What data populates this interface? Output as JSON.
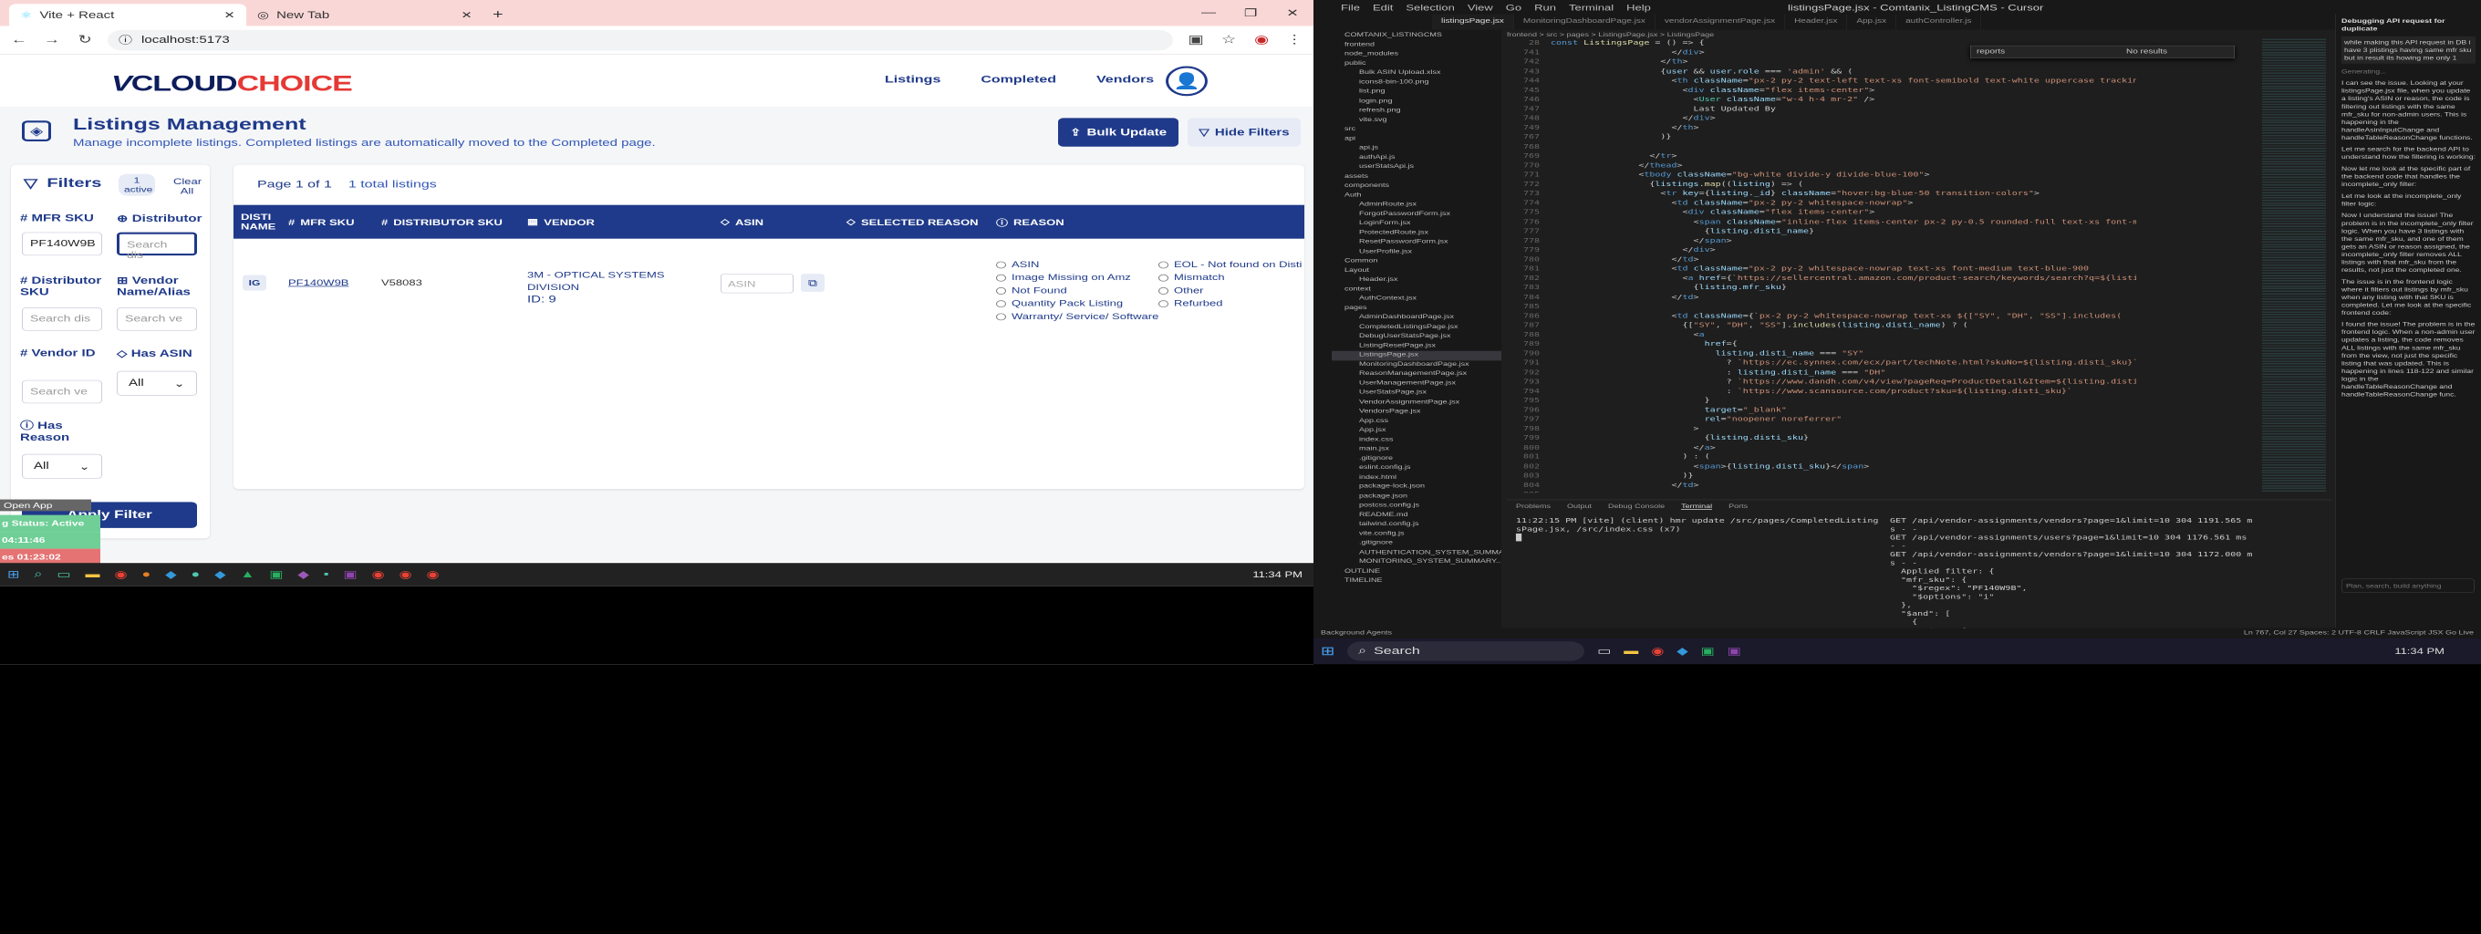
{
  "browser": {
    "tabs": [
      {
        "title": "Vite + React"
      },
      {
        "title": "New Tab"
      }
    ],
    "url": "localhost:5173"
  },
  "app": {
    "logo": {
      "v": "V",
      "cloud": "CLOUD",
      "choice": "CHOICE"
    },
    "nav": [
      "Listings",
      "Completed",
      "Vendors"
    ],
    "header": {
      "title": "Listings Management",
      "subtitle": "Manage incomplete listings. Completed listings are automatically moved to the Completed page.",
      "bulk_update": "Bulk Update",
      "hide_filters": "Hide Filters"
    },
    "filters": {
      "title": "Filters",
      "active_badge": "1 active",
      "clear_all": "Clear All",
      "mfr_sku_label": "MFR SKU",
      "mfr_sku_value": "PF140W9B",
      "distributor_label": "Distributor",
      "distributor_placeholder": "Search dis",
      "distributor_sku_label": "Distributor SKU",
      "distributor_sku_placeholder": "Search dis",
      "vendor_name_label": "Vendor Name/Alias",
      "vendor_name_placeholder": "Search ve",
      "vendor_id_label": "Vendor ID",
      "vendor_id_placeholder": "Search ve",
      "has_asin_label": "Has ASIN",
      "has_asin_value": "All",
      "has_reason_label": "Has Reason",
      "has_reason_value": "All",
      "apply": "Apply Filter"
    },
    "table": {
      "page_info": "Page 1 of 1",
      "total": "1 total listings",
      "columns": [
        "DISTI NAME",
        "MFR SKU",
        "DISTRIBUTOR SKU",
        "VENDOR",
        "ASIN",
        "SELECTED REASON",
        "REASON"
      ],
      "row": {
        "disti": "IG",
        "mfr_sku": "PF140W9B",
        "disti_sku": "V58083",
        "vendor": "3M - OPTICAL SYSTEMS DIVISION",
        "vendor_id": "ID: 9",
        "asin_placeholder": "ASIN",
        "reasons_a": [
          "ASIN",
          "Image Missing on Amz",
          "Not Found",
          "Quantity Pack Listing",
          "Warranty/ Service/ Software"
        ],
        "reasons_b": [
          "EOL - Not found on Disti",
          "Mismatch",
          "Other",
          "Refurbed"
        ]
      }
    },
    "side_widget": {
      "open_app": "Open App",
      "status": "g Status: Active",
      "time1": "04:11:46",
      "time2": "es 01:23:02"
    },
    "taskbar_clock": "11:34 PM"
  },
  "vscode": {
    "menu": [
      "File",
      "Edit",
      "Selection",
      "View",
      "Go",
      "Run",
      "Terminal",
      "Help"
    ],
    "title": "listingsPage.jsx - Comtanix_ListingCMS - Cursor",
    "tabs": [
      "listingsPage.jsx",
      "MonitoringDashboardPage.jsx",
      "vendorAssignmentPage.jsx",
      "Header.jsx",
      "App.jsx",
      "authController.js"
    ],
    "breadcrumb": "frontend > src > pages > ListingsPage.jsx > ListingsPage",
    "find_text": "reports",
    "find_result": "No results",
    "explorer": [
      "COMTANIX_LISTINGCMS",
      "frontend",
      "node_modules",
      "public",
      "Bulk ASIN Upload.xlsx",
      "icons8-bin-100.png",
      "list.png",
      "login.png",
      "refresh.png",
      "vite.svg",
      "src",
      "api",
      "api.js",
      "authApi.js",
      "userStatsApi.js",
      "assets",
      "components",
      "Auth",
      "AdminRoute.jsx",
      "ForgotPasswordForm.jsx",
      "LoginForm.jsx",
      "ProtectedRoute.jsx",
      "ResetPasswordForm.jsx",
      "UserProfile.jsx",
      "Common",
      "Layout",
      "Header.jsx",
      "context",
      "AuthContext.jsx",
      "pages",
      "AdminDashboardPage.jsx",
      "CompletedListingsPage.jsx",
      "DebugUserStatsPage.jsx",
      "ListingResetPage.jsx",
      "ListingsPage.jsx",
      "MonitoringDashboardPage.jsx",
      "ReasonManagementPage.jsx",
      "UserManagementPage.jsx",
      "UserStatsPage.jsx",
      "VendorAssignmentPage.jsx",
      "VendorsPage.jsx",
      "App.css",
      "App.jsx",
      "index.css",
      "main.jsx",
      ".gitignore",
      "eslint.config.js",
      "index.html",
      "package-lock.json",
      "package.json",
      "postcss.config.js",
      "README.md",
      "tailwind.config.js",
      "vite.config.js",
      ".gitignore",
      "AUTHENTICATION_SYSTEM_SUMMA...",
      "MONITORING_SYSTEM_SUMMARY...",
      "OUTLINE",
      "TIMELINE"
    ],
    "panel_tabs": [
      "Problems",
      "Output",
      "Debug Console",
      "Terminal",
      "Ports"
    ],
    "terminal_left": "11:22:15 PM [vite] (client) hmr update /src/pages/CompletedListing\nsPage.jsx, /src/index.css (x7)\n█",
    "terminal_right": "GET /api/vendor-assignments/vendors?page=1&limit=10 304 1191.565 m\ns - -\nGET /api/vendor-assignments/users?page=1&limit=10 304 1176.561 ms\n- -\nGET /api/vendor-assignments/vendors?page=1&limit=10 304 1172.000 m\ns - -\n  Applied filter: {\n  \"mfr_sku\": {\n    \"$regex\": \"PF140W9B\",\n    \"$options\": \"i\"\n  },\n  \"$and\": [\n    {\n      \"$or\": [\n",
    "chat": {
      "title": "Debugging API request for duplicate",
      "user_msg": "while making this API request in DB i have 3 plistings having same mfr sku but in result its howing me only 1",
      "p1": "I can see the issue. Looking at your listingsPage.jsx file, when you update a listing's ASIN or reason, the code is filtering out listings with the same mfr_sku for non-admin users. This is happening in the handleAsinInputChange and handleTableReasonChange functions.",
      "p2": "Let me search for the backend API to understand how the filtering is working:",
      "p3": "Now let me look at the specific part of the backend code that handles the incomplete_only filter:",
      "p4": "Let me look at the incomplete_only filter logic:",
      "p5": "Now I understand the issue! The problem is in the incomplete_only filter logic. When you have 3 listings with the same mfr_sku, and one of them gets an ASIN or reason assigned, the incomplete_only filter removes ALL listings with that mfr_sku from the results, not just the completed one.",
      "p6": "The issue is in the frontend logic where it filters out listings by mfr_sku when any listing with that SKU is completed. Let me look at the specific frontend code:",
      "p7": "I found the issue! The problem is in the frontend logic. When a non-admin user updates a listing, the code removes ALL listings with the same mfr_sku from the view, not just the specific listing that was updated. This is happening in lines 118-122 and similar logic in the handleTableReasonChange and handleTableReasonChange func.",
      "generating": "Generating...",
      "input_ph": "Plan, search, build anything"
    },
    "status_left": "Background Agents",
    "status_right": "Ln 767, Col 27   Spaces: 2   UTF-8   CRLF   JavaScript JSX   Go Live",
    "search": "Search",
    "clock": "11:34 PM"
  }
}
